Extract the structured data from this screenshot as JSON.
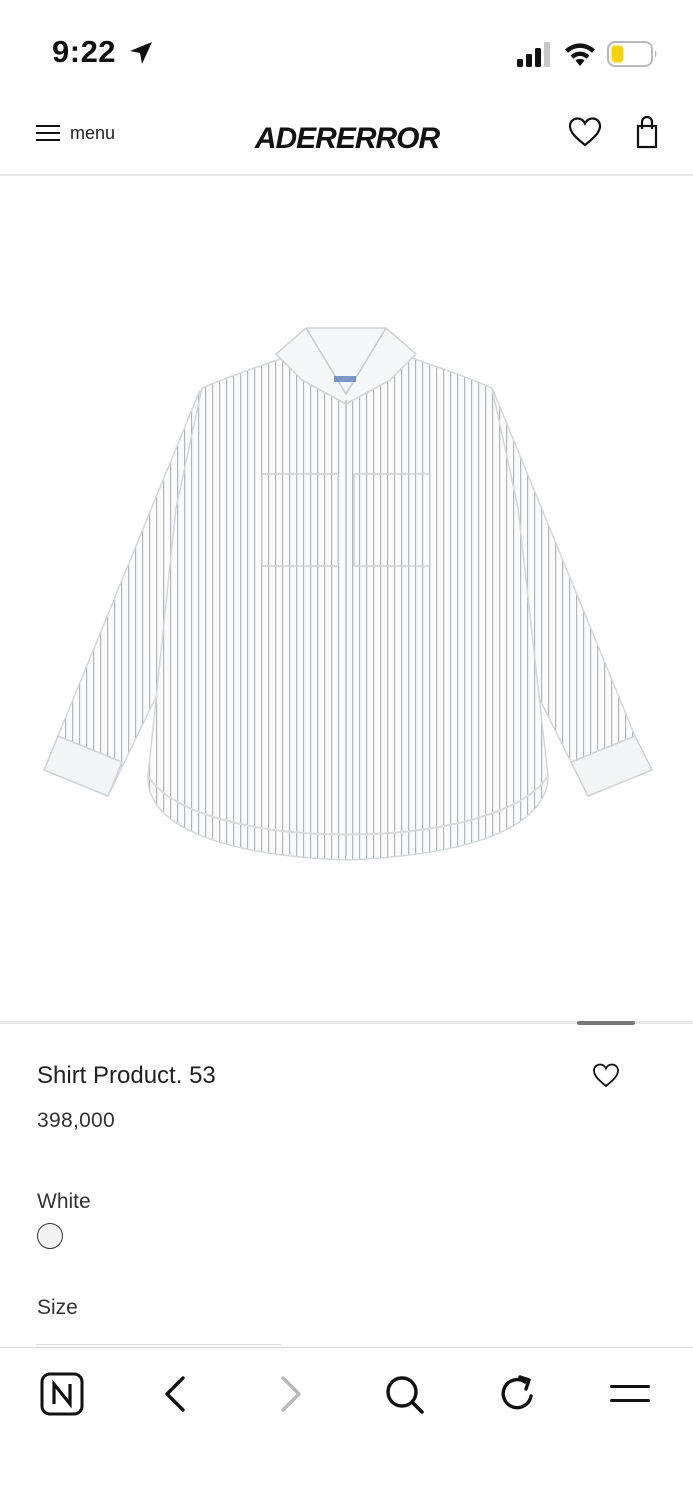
{
  "status_bar": {
    "time": "9:22",
    "icons": [
      "location-arrow-icon",
      "cellular-signal-icon",
      "wifi-icon",
      "battery-low-icon"
    ],
    "battery_color": "#f5d30a"
  },
  "header": {
    "menu_label": "menu",
    "logo_text": "ADERERROR",
    "icons": [
      "hamburger-icon",
      "heart-icon",
      "shopping-bag-icon"
    ]
  },
  "product": {
    "title": "Shirt Product. 53",
    "price": "398,000",
    "color_label": "White",
    "color_swatch": "#f3f3f3",
    "size_label": "Size"
  },
  "browser_toolbar": {
    "items": [
      "naver-home-icon",
      "back-icon",
      "forward-icon",
      "search-icon",
      "refresh-icon",
      "menu-icon"
    ]
  },
  "colors": {
    "text": "#111111",
    "divider": "#e6e6e6",
    "indicator": "#777777",
    "forward_disabled": "#b8b8b8"
  }
}
